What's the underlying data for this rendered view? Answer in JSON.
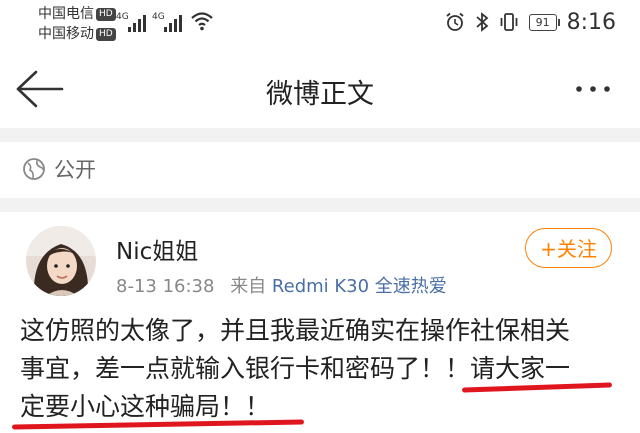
{
  "status_bar": {
    "carrier_1": "中国电信",
    "carrier_2": "中国移动",
    "hd_badge": "HD",
    "network_1": "4G",
    "network_2": "4G",
    "battery": "91",
    "time": "8:16",
    "icons": [
      "signal-icon",
      "wifi-icon",
      "alarm-icon",
      "bluetooth-icon",
      "vibrate-icon",
      "battery-icon"
    ]
  },
  "nav": {
    "title": "微博正文",
    "back_icon": "arrow-left-icon",
    "more_icon": "more-dots-icon"
  },
  "visibility": {
    "label": "公开",
    "icon": "globe-icon"
  },
  "post": {
    "username": "Nic姐姐",
    "date": "8-13 16:38",
    "source_prefix": "来自",
    "source": "Redmi K30 全速热爱",
    "follow_label": "+关注",
    "text_line_1": "这仿照的太像了，并且我最近确实在操作社保相关",
    "text_line_2": "事宜，差一点就输入银行卡和密码了！！请大家一",
    "text_line_3": "定要小心这种骗局！！"
  },
  "colors": {
    "accent_orange": "#ff8200",
    "source_blue": "#4a6fa5",
    "underline_red": "#e0161e"
  }
}
